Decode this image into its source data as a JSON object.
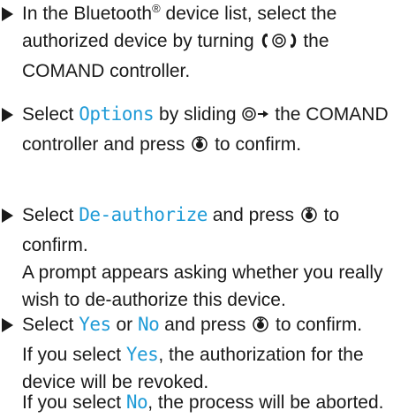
{
  "steps": [
    {
      "part1": "In the Bluetooth",
      "reg": "®",
      "part2": " device list, select the authorized device by turning ",
      "part3": " the COMAND controller."
    },
    {
      "part1": "Select ",
      "kw1": "Options",
      "part2": " by sliding ",
      "part3": " the COMAND controller and press ",
      "part4": " to confirm."
    },
    {
      "part1": "Select ",
      "kw1": "De-authorize",
      "part2": " and press ",
      "part3": " to confirm.",
      "result": "A prompt appears asking whether you really wish to de-authorize this device."
    },
    {
      "part1": "Select ",
      "kw1": "Yes",
      "part2": " or ",
      "kw2": "No",
      "part3": " and press ",
      "part4": " to confirm.",
      "res1": "If you select ",
      "res_kw": "Yes",
      "res2": ", the authorization for the device will be revoked."
    }
  ],
  "note": {
    "part1": "If you select ",
    "kw": "No",
    "part2": ", the process will be aborted."
  },
  "colors": {
    "keyword": "#1f9bd7",
    "text": "#1a1a1a"
  },
  "icons": [
    "triangle-bullet-icon",
    "turn-controller-icon",
    "slide-controller-icon",
    "press-controller-icon"
  ]
}
